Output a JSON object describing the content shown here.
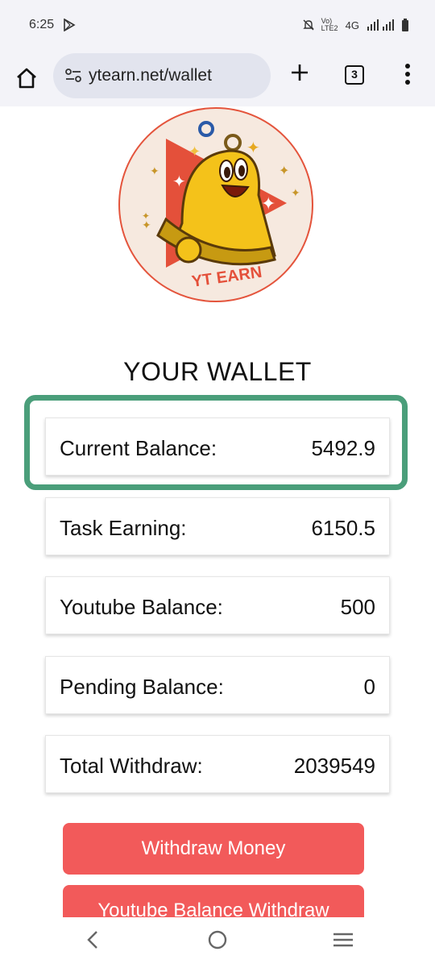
{
  "status": {
    "time": "6:25",
    "network": "Vo) LTE2",
    "network_type": "4G",
    "icons": [
      "play-store-icon",
      "silent-icon",
      "signal-icon",
      "battery-icon"
    ]
  },
  "browser": {
    "url": "ytearn.net/wallet",
    "tab_count": "3"
  },
  "logo": {
    "text": "YT EARN",
    "colors": {
      "background": "#f6e9df",
      "border": "#e4543c",
      "play": "#e4503a",
      "bell": "#f4c21a"
    }
  },
  "wallet": {
    "title": "YOUR WALLET",
    "rows": [
      {
        "label": "Current Balance:",
        "value": "5492.9"
      },
      {
        "label": "Task Earning:",
        "value": "6150.5"
      },
      {
        "label": "Youtube Balance:",
        "value": "500"
      },
      {
        "label": "Pending Balance:",
        "value": "0"
      },
      {
        "label": "Total Withdraw:",
        "value": "2039549"
      }
    ],
    "highlight_color": "#4a9e7a"
  },
  "buttons": {
    "withdraw_money": "Withdraw Money",
    "youtube_withdraw": "Youtube Balance Withdraw",
    "color": "#f25a5a"
  }
}
